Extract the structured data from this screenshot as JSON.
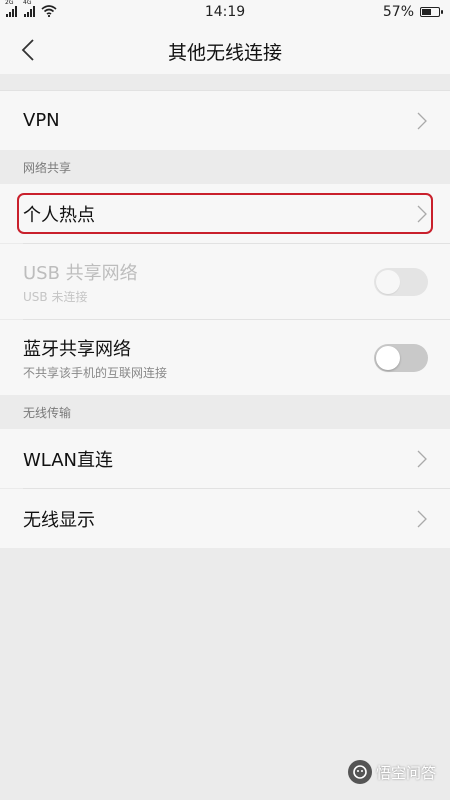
{
  "status_bar": {
    "sim1_network": "2G",
    "sim2_network": "4G",
    "time": "14:19",
    "battery_percent": "57%",
    "battery_level": 0.57,
    "icons": [
      "signal-icon",
      "signal-icon",
      "wifi-icon",
      "battery-icon"
    ]
  },
  "header": {
    "title": "其他无线连接",
    "back_icon": "chevron-left-icon"
  },
  "rows": {
    "vpn": {
      "label": "VPN"
    },
    "hotspot": {
      "label": "个人热点"
    },
    "usb": {
      "label": "USB 共享网络",
      "sub": "USB 未连接",
      "enabled": false,
      "on": false
    },
    "bluetooth": {
      "label": "蓝牙共享网络",
      "sub": "不共享该手机的互联网连接",
      "on": false
    },
    "wlan_direct": {
      "label": "WLAN直连"
    },
    "wireless_display": {
      "label": "无线显示"
    }
  },
  "sections": {
    "network_sharing": "网络共享",
    "wireless_transfer": "无线传输"
  },
  "colors": {
    "highlight": "#c9202c",
    "toggle_off": "#c9c9c9"
  },
  "watermark": {
    "text": "悟空问答"
  }
}
